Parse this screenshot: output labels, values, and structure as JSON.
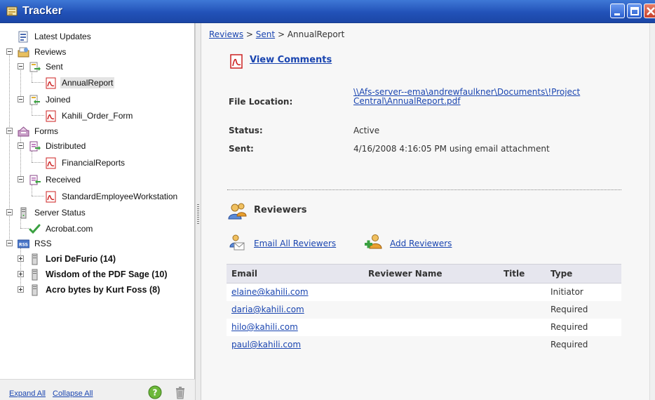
{
  "window": {
    "title": "Tracker"
  },
  "tree": {
    "latest_updates": "Latest Updates",
    "reviews": "Reviews",
    "sent": "Sent",
    "annual_report": "AnnualReport",
    "joined": "Joined",
    "kahili_order_form": "Kahili_Order_Form",
    "forms": "Forms",
    "distributed": "Distributed",
    "financial_reports": "FinancialReports",
    "received": "Received",
    "standard_employee_workstation": "StandardEmployeeWorkstation",
    "server_status": "Server Status",
    "acrobat_com": "Acrobat.com",
    "rss": "RSS",
    "rss_feeds": [
      "Lori DeFurio (14)",
      "Wisdom of the PDF Sage (10)",
      "Acro bytes by Kurt Foss (8)"
    ]
  },
  "footer": {
    "expand_all": "Expand All",
    "collapse_all": "Collapse All"
  },
  "breadcrumb": {
    "reviews": "Reviews",
    "sep": ">",
    "sent": "Sent",
    "current": "AnnualReport"
  },
  "details": {
    "view_comments": "View Comments",
    "file_location_label": "File Location:",
    "file_location_line1": "\\\\Afs-server--ema\\andrewfaulkner\\Documents\\!Project",
    "file_location_line2": "Central\\AnnualReport.pdf",
    "status_label": "Status:",
    "status_value": "Active",
    "sent_label": "Sent:",
    "sent_value": "4/16/2008 4:16:05 PM using email attachment"
  },
  "reviewers": {
    "title": "Reviewers",
    "email_all": "Email All Reviewers",
    "add": "Add Reviewers",
    "columns": [
      "Email",
      "Reviewer Name",
      "Title",
      "Type"
    ],
    "rows": [
      {
        "email": "elaine@kahili.com",
        "name": "",
        "title": "",
        "type": "Initiator"
      },
      {
        "email": "daria@kahili.com",
        "name": "",
        "title": "",
        "type": "Required"
      },
      {
        "email": "hilo@kahili.com",
        "name": "",
        "title": "",
        "type": "Required"
      },
      {
        "email": "paul@kahili.com",
        "name": "",
        "title": "",
        "type": "Required"
      }
    ]
  },
  "colors": {
    "titlebar": "#2252b8",
    "link": "#1a45b0",
    "pdf_red": "#cc2020"
  }
}
